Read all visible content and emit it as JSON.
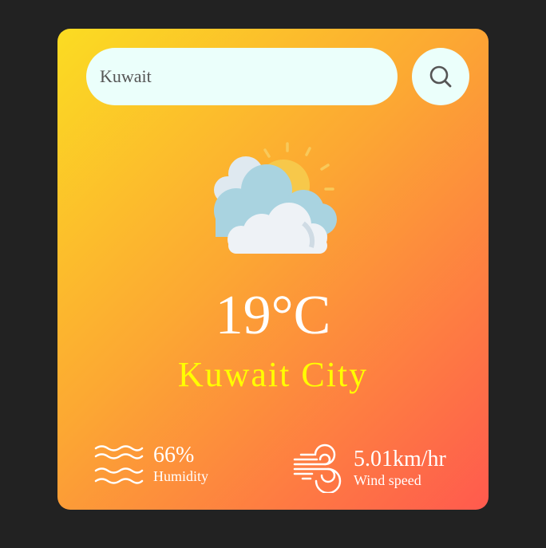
{
  "search": {
    "value": "Kuwait"
  },
  "weather": {
    "icon": "partly-cloudy-sun-icon",
    "temperature": "19°C",
    "city": "Kuwait City"
  },
  "details": {
    "humidity": {
      "value": "66%",
      "label": "Humidity",
      "icon": "humidity-waves-icon"
    },
    "wind": {
      "value": "5.01km/hr",
      "label": "Wind speed",
      "icon": "wind-icon"
    }
  },
  "colors": {
    "page_background": "#222222",
    "card_gradient_start": "#fbdc22",
    "card_gradient_mid": "#fca733",
    "card_gradient_end": "#ff5a4e",
    "input_background": "#ebfffb",
    "temperature_text": "#ffffff",
    "city_text": "#ffff00"
  }
}
